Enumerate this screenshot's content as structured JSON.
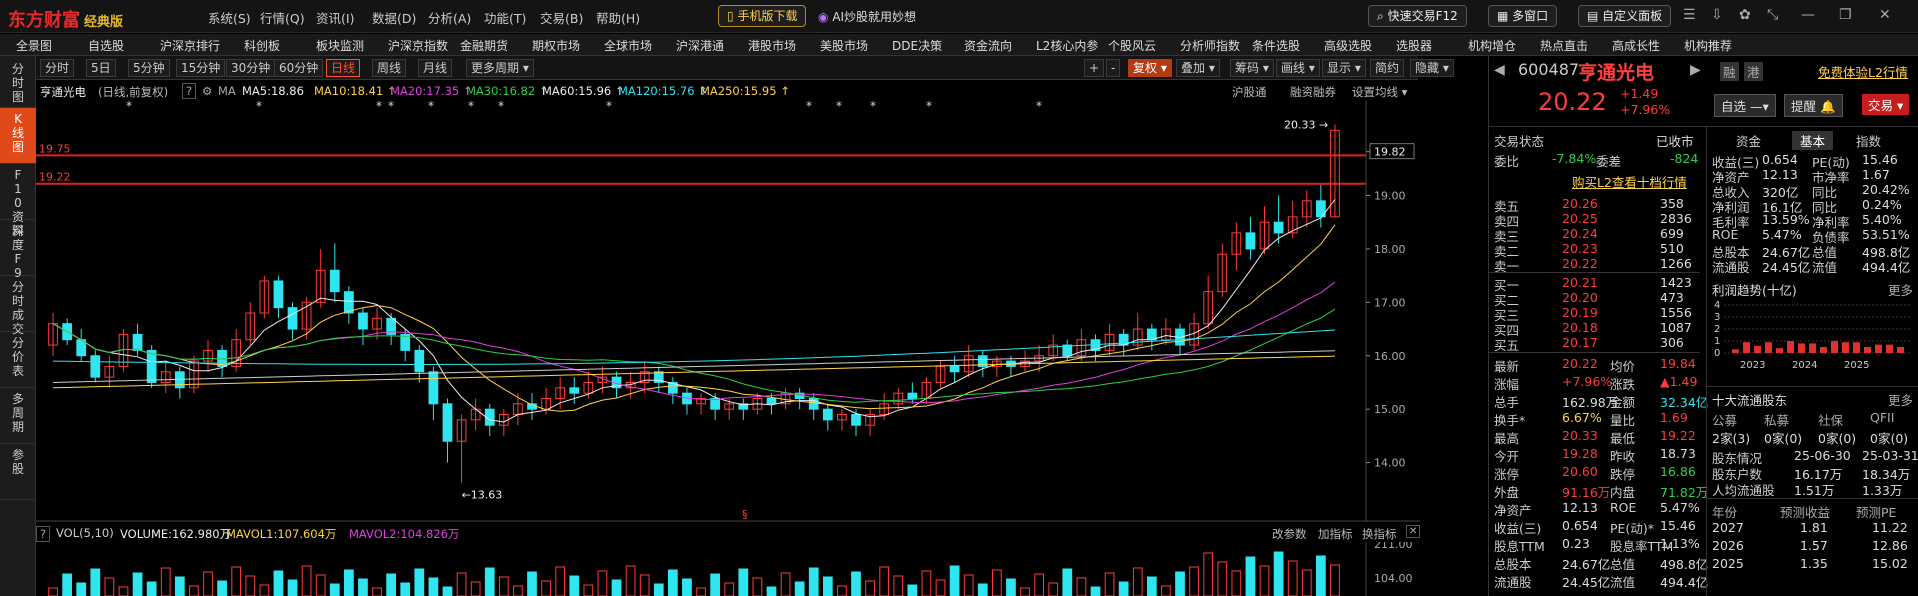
{
  "titlebar": {
    "logo": "东方财富",
    "logo_sub": "经典版",
    "menus": [
      "系统(S)",
      "行情(Q)",
      "资讯(I)",
      "数据(D)",
      "分析(A)",
      "功能(T)",
      "交易(B)",
      "帮助(H)"
    ],
    "mobile_download": "手机版下载",
    "ai_label": "AI炒股就用妙想",
    "quick_trade": "快速交易F12",
    "multi_window": "多窗口",
    "custom_page": "自定义面板"
  },
  "navbar": {
    "items": [
      "全景图",
      "自选股",
      "沪深京排行",
      "科创板",
      "板块监测",
      "沪深京指数",
      "金融期货",
      "期权市场",
      "全球市场",
      "沪深港通",
      "港股市场",
      "美股市场",
      "DDE决策",
      "资金流向",
      "L2核心内参",
      "个股风云",
      "分析师指数",
      "条件选股",
      "高级选股",
      "选股器",
      "机构增仓",
      "热点直击",
      "高成长性",
      "机构推荐"
    ]
  },
  "lefttabs": [
    "分时图",
    "K线图",
    "F10资料",
    "深度F9",
    "分时成交",
    "分价表",
    "多周期",
    "参股"
  ],
  "toolbar": {
    "periods": [
      "分时",
      "5日",
      "5分钟",
      "15分钟",
      "30分钟",
      "60分钟",
      "日线",
      "周线",
      "月线",
      "更多周期"
    ],
    "right": [
      "+",
      "-",
      "复权",
      "叠加",
      "筹码",
      "画线",
      "显示",
      "简约",
      "隐藏"
    ]
  },
  "maheader": {
    "name": "亨通光电",
    "mode": "(日线,前复权)",
    "ma_label": "MA",
    "items": [
      {
        "label": "MA5:18.86",
        "color": "#eeeeee"
      },
      {
        "label": "MA10:18.41",
        "color": "#ffd24a"
      },
      {
        "label": "MA20:17.35",
        "color": "#e040e0"
      },
      {
        "label": "MA30:16.82",
        "color": "#2ad04a"
      },
      {
        "label": "MA60:15.96",
        "color": "#eeeeee"
      },
      {
        "label": "MA120:15.76",
        "color": "#2fe5f0"
      },
      {
        "label": "MA250:15.95",
        "color": "#ffd24a"
      }
    ],
    "links": [
      "沪股通",
      "融资融券",
      "设置均线"
    ]
  },
  "chart_data": {
    "type": "candlestick",
    "y_ticks": [
      "19.82",
      "19.00",
      "18.00",
      "17.00",
      "16.00",
      "15.00",
      "14.00"
    ],
    "levels": [
      "19.75",
      "19.22"
    ],
    "high_label": "20.33",
    "low_label": "13.63",
    "ylim": [
      13.3,
      20.6
    ],
    "candles": [
      [
        16.2,
        16.6,
        16.0,
        16.8
      ],
      [
        16.6,
        16.3,
        16.2,
        16.7
      ],
      [
        16.3,
        16.0,
        15.9,
        16.5
      ],
      [
        16.0,
        15.6,
        15.5,
        16.1
      ],
      [
        15.6,
        15.8,
        15.4,
        16.0
      ],
      [
        15.8,
        16.4,
        15.7,
        16.5
      ],
      [
        16.4,
        16.1,
        16.0,
        16.6
      ],
      [
        16.1,
        15.5,
        15.4,
        16.2
      ],
      [
        15.5,
        15.7,
        15.3,
        15.9
      ],
      [
        15.7,
        15.4,
        15.2,
        15.8
      ],
      [
        15.4,
        15.9,
        15.3,
        16.0
      ],
      [
        15.9,
        16.1,
        15.7,
        16.3
      ],
      [
        16.1,
        15.8,
        15.6,
        16.2
      ],
      [
        15.8,
        16.3,
        15.7,
        16.5
      ],
      [
        16.3,
        16.8,
        16.2,
        17.0
      ],
      [
        16.8,
        17.4,
        16.7,
        17.5
      ],
      [
        17.4,
        16.9,
        16.7,
        17.5
      ],
      [
        16.9,
        16.5,
        16.3,
        17.0
      ],
      [
        16.5,
        17.0,
        16.3,
        17.1
      ],
      [
        17.0,
        17.6,
        16.9,
        18.0
      ],
      [
        17.6,
        17.2,
        17.0,
        18.1
      ],
      [
        17.2,
        16.8,
        16.6,
        17.3
      ],
      [
        16.8,
        16.5,
        16.2,
        16.9
      ],
      [
        16.5,
        16.7,
        16.3,
        16.9
      ],
      [
        16.7,
        16.4,
        16.2,
        16.8
      ],
      [
        16.4,
        16.1,
        15.9,
        16.5
      ],
      [
        16.1,
        15.7,
        15.5,
        16.2
      ],
      [
        15.7,
        15.1,
        14.8,
        15.8
      ],
      [
        15.1,
        14.4,
        14.0,
        15.2
      ],
      [
        14.4,
        14.8,
        13.63,
        14.9
      ],
      [
        14.8,
        15.0,
        14.6,
        15.2
      ],
      [
        15.0,
        14.7,
        14.5,
        15.1
      ],
      [
        14.7,
        14.9,
        14.5,
        15.0
      ],
      [
        14.9,
        15.1,
        14.7,
        15.3
      ],
      [
        15.1,
        15.0,
        14.8,
        15.3
      ],
      [
        15.0,
        15.2,
        14.9,
        15.4
      ],
      [
        15.2,
        15.4,
        15.0,
        15.6
      ],
      [
        15.4,
        15.3,
        15.1,
        15.6
      ],
      [
        15.3,
        15.5,
        15.2,
        15.7
      ],
      [
        15.5,
        15.6,
        15.3,
        15.8
      ],
      [
        15.6,
        15.4,
        15.2,
        15.7
      ],
      [
        15.4,
        15.5,
        15.2,
        15.7
      ],
      [
        15.5,
        15.7,
        15.3,
        15.9
      ],
      [
        15.7,
        15.5,
        15.3,
        15.8
      ],
      [
        15.5,
        15.3,
        15.1,
        15.6
      ],
      [
        15.3,
        15.1,
        14.9,
        15.4
      ],
      [
        15.1,
        15.2,
        14.9,
        15.3
      ],
      [
        15.2,
        15.0,
        14.8,
        15.3
      ],
      [
        15.0,
        15.1,
        14.8,
        15.2
      ],
      [
        15.1,
        15.0,
        14.8,
        15.2
      ],
      [
        15.0,
        15.2,
        14.9,
        15.3
      ],
      [
        15.2,
        15.1,
        14.9,
        15.3
      ],
      [
        15.1,
        15.3,
        15.0,
        15.4
      ],
      [
        15.3,
        15.2,
        15.0,
        15.4
      ],
      [
        15.2,
        15.0,
        14.8,
        15.3
      ],
      [
        15.0,
        14.8,
        14.6,
        15.1
      ],
      [
        14.8,
        14.9,
        14.6,
        15.0
      ],
      [
        14.9,
        14.7,
        14.5,
        15.0
      ],
      [
        14.7,
        14.9,
        14.5,
        15.0
      ],
      [
        14.9,
        15.1,
        14.8,
        15.3
      ],
      [
        15.1,
        15.3,
        15.0,
        15.4
      ],
      [
        15.3,
        15.2,
        15.1,
        15.5
      ],
      [
        15.2,
        15.5,
        15.1,
        15.6
      ],
      [
        15.5,
        15.8,
        15.4,
        15.9
      ],
      [
        15.8,
        15.7,
        15.5,
        16.0
      ],
      [
        15.7,
        16.0,
        15.6,
        16.2
      ],
      [
        16.0,
        15.8,
        15.6,
        16.1
      ],
      [
        15.8,
        15.9,
        15.6,
        16.0
      ],
      [
        15.9,
        15.8,
        15.6,
        16.0
      ],
      [
        15.8,
        15.9,
        15.7,
        16.1
      ],
      [
        15.9,
        16.0,
        15.7,
        16.2
      ],
      [
        16.0,
        16.2,
        15.9,
        16.4
      ],
      [
        16.2,
        16.0,
        15.9,
        16.3
      ],
      [
        16.0,
        16.3,
        15.9,
        16.5
      ],
      [
        16.3,
        16.1,
        15.9,
        16.4
      ],
      [
        16.1,
        16.4,
        16.0,
        16.6
      ],
      [
        16.4,
        16.2,
        16.0,
        16.5
      ],
      [
        16.2,
        16.5,
        16.1,
        16.8
      ],
      [
        16.5,
        16.3,
        16.1,
        16.6
      ],
      [
        16.3,
        16.5,
        16.2,
        16.7
      ],
      [
        16.5,
        16.2,
        16.0,
        16.6
      ],
      [
        16.2,
        16.6,
        16.1,
        16.8
      ],
      [
        16.6,
        17.2,
        16.5,
        17.5
      ],
      [
        17.2,
        17.9,
        17.1,
        18.1
      ],
      [
        17.9,
        18.3,
        17.6,
        18.5
      ],
      [
        18.3,
        18.0,
        17.8,
        18.6
      ],
      [
        18.0,
        18.5,
        17.9,
        18.8
      ],
      [
        18.5,
        18.3,
        18.1,
        19.0
      ],
      [
        18.3,
        18.6,
        18.2,
        18.9
      ],
      [
        18.6,
        18.9,
        18.4,
        19.1
      ],
      [
        18.9,
        18.6,
        18.4,
        19.2
      ],
      [
        18.6,
        20.22,
        18.6,
        20.33
      ]
    ],
    "markers": "*",
    "marker_count": 14,
    "special_marker": "§"
  },
  "volheader": {
    "vol_label": "VOL(5,10)",
    "volume": "VOLUME:162.980万",
    "mavol1": "MAVOL1:107.604万",
    "mavol2": "MAVOL2:104.826万",
    "links": [
      "改参数",
      "加指标",
      "换指标"
    ],
    "ticks": [
      "211.00",
      "104.00"
    ]
  },
  "quote": {
    "code": "600487",
    "name": "亨通光电",
    "tag1": "融",
    "tag2": "港",
    "l2_link": "免费体验L2行情",
    "price": "20.22",
    "change": "+1.49",
    "change_pct": "+7.96%",
    "self_select": "自选",
    "remind": "提醒",
    "trade": "交易",
    "status_label": "交易状态",
    "status_value": "已收市",
    "weibi_label": "委比",
    "weibi_value": "-7.84%",
    "weicha_label": "委差",
    "weicha_value": "-824",
    "buy_l2": "购买L2查看十档行情",
    "sells": [
      {
        "label": "卖五",
        "price": "20.26",
        "vol": "358"
      },
      {
        "label": "卖四",
        "price": "20.25",
        "vol": "2836"
      },
      {
        "label": "卖三",
        "price": "20.24",
        "vol": "699"
      },
      {
        "label": "卖二",
        "price": "20.23",
        "vol": "510"
      },
      {
        "label": "卖一",
        "price": "20.22",
        "vol": "1266"
      }
    ],
    "buys": [
      {
        "label": "买一",
        "price": "20.21",
        "vol": "1423"
      },
      {
        "label": "买二",
        "price": "20.20",
        "vol": "473"
      },
      {
        "label": "买三",
        "price": "20.19",
        "vol": "1556"
      },
      {
        "label": "买四",
        "price": "20.18",
        "vol": "1087"
      },
      {
        "label": "买五",
        "price": "20.17",
        "vol": "306"
      }
    ],
    "stats": [
      [
        "最新",
        "20.22",
        "red",
        "均价",
        "19.84",
        "red"
      ],
      [
        "涨幅",
        "+7.96%",
        "red",
        "涨跌",
        "▲1.49",
        "red"
      ],
      [
        "总手",
        "162.98万",
        "white",
        "金额",
        "32.34亿",
        "cyan"
      ],
      [
        "换手*",
        "6.67%",
        "yellow",
        "量比",
        "1.69",
        "red"
      ],
      [
        "最高",
        "20.33",
        "red",
        "最低",
        "19.22",
        "red"
      ],
      [
        "今开",
        "19.28",
        "red",
        "昨收",
        "18.73",
        "white"
      ],
      [
        "涨停",
        "20.60",
        "red",
        "跌停",
        "16.86",
        "green"
      ],
      [
        "外盘",
        "91.16万",
        "red",
        "内盘",
        "71.82万",
        "green"
      ],
      [
        "净资产",
        "12.13",
        "white",
        "ROE",
        "5.47%",
        "white"
      ],
      [
        "收益(三)",
        "0.654",
        "white",
        "PE(动)*",
        "15.46",
        "white"
      ],
      [
        "股息TTM",
        "0.23",
        "white",
        "股息率TTM",
        "1.13%",
        "white"
      ],
      [
        "总股本",
        "24.67亿",
        "white",
        "总值",
        "498.8亿",
        "white"
      ],
      [
        "流通股",
        "24.45亿",
        "white",
        "流值",
        "494.4亿",
        "white"
      ]
    ]
  },
  "fundamentals": {
    "tabs": [
      "资金",
      "基本",
      "指数"
    ],
    "rows": [
      [
        "收益(三)",
        "0.654",
        "PE(动)",
        "15.46"
      ],
      [
        "净资产",
        "12.13",
        "市净率",
        "1.67"
      ],
      [
        "总收入",
        "320亿",
        "同比",
        "20.42%"
      ],
      [
        "净利润",
        "16.1亿",
        "同比",
        "0.24%"
      ],
      [
        "毛利率",
        "13.59%",
        "净利率",
        "5.40%"
      ],
      [
        "ROE",
        "5.47%",
        "负债率",
        "53.51%"
      ],
      [
        "总股本",
        "24.67亿",
        "总值",
        "498.8亿"
      ],
      [
        "流通股",
        "24.45亿",
        "流值",
        "494.4亿"
      ]
    ],
    "profit_title": "利润趋势(十亿)",
    "more": "更多",
    "profit_chart": {
      "type": "bar",
      "y_ticks": [
        "4",
        "3",
        "2",
        "1",
        "0"
      ],
      "x_labels": [
        "2023",
        "2024",
        "2025"
      ],
      "values": [
        0.3,
        0.9,
        0.6,
        0.9,
        0.4,
        1.0,
        0.8,
        0.8,
        0.5,
        1.0,
        0.9,
        0.9,
        0.5,
        0.7,
        0.7,
        0.5
      ]
    },
    "holders_title": "十大流通股东",
    "holders_head": [
      "公募",
      "私募",
      "社保",
      "QFII"
    ],
    "holders_vals": [
      "2家(3)",
      "0家(0)",
      "0家(0)",
      "0家(0)"
    ],
    "holders_rows": [
      [
        "股东情况",
        "25-06-30",
        "25-03-31"
      ],
      [
        "股东户数",
        "16.17万",
        "18.34万"
      ],
      [
        "人均流通股",
        "1.51万",
        "1.33万"
      ]
    ],
    "forecast_head": [
      "年份",
      "预测收益",
      "预测PE"
    ],
    "forecast_rows": [
      [
        "2027",
        "1.81",
        "11.22"
      ],
      [
        "2026",
        "1.57",
        "12.86"
      ],
      [
        "2025",
        "1.35",
        "15.02"
      ]
    ]
  }
}
